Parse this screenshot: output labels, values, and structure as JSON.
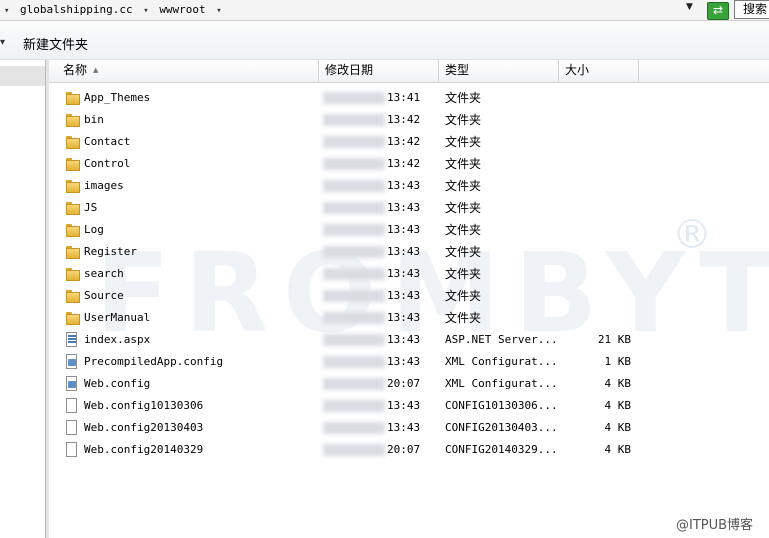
{
  "address": {
    "segments": [
      "globalshipping.cc",
      "wwwroot"
    ],
    "search_label": "搜索"
  },
  "toolbar": {
    "new_folder_label": "新建文件夹"
  },
  "columns": {
    "name": "名称",
    "date": "修改日期",
    "type": "类型",
    "size": "大小"
  },
  "files": [
    {
      "name": "App_Themes",
      "time": "13:41",
      "type": "文件夹",
      "size": "",
      "icon": "folder-icon"
    },
    {
      "name": "bin",
      "time": "13:42",
      "type": "文件夹",
      "size": "",
      "icon": "folder-icon"
    },
    {
      "name": "Contact",
      "time": "13:42",
      "type": "文件夹",
      "size": "",
      "icon": "folder-icon"
    },
    {
      "name": "Control",
      "time": "13:42",
      "type": "文件夹",
      "size": "",
      "icon": "folder-icon"
    },
    {
      "name": "images",
      "time": "13:43",
      "type": "文件夹",
      "size": "",
      "icon": "folder-icon"
    },
    {
      "name": "JS",
      "time": "13:43",
      "type": "文件夹",
      "size": "",
      "icon": "folder-icon"
    },
    {
      "name": "Log",
      "time": "13:43",
      "type": "文件夹",
      "size": "",
      "icon": "folder-icon"
    },
    {
      "name": "Register",
      "time": "13:43",
      "type": "文件夹",
      "size": "",
      "icon": "folder-icon"
    },
    {
      "name": "search",
      "time": "13:43",
      "type": "文件夹",
      "size": "",
      "icon": "folder-icon"
    },
    {
      "name": "Source",
      "time": "13:43",
      "type": "文件夹",
      "size": "",
      "icon": "folder-icon"
    },
    {
      "name": "UserManual",
      "time": "13:43",
      "type": "文件夹",
      "size": "",
      "icon": "folder-icon"
    },
    {
      "name": "index.aspx",
      "time": "13:43",
      "type": "ASP.NET Server...",
      "size": "21 KB",
      "icon": "aspx-file-icon"
    },
    {
      "name": "PrecompiledApp.config",
      "time": "13:43",
      "type": "XML Configurat...",
      "size": "1 KB",
      "icon": "config-file-icon"
    },
    {
      "name": "Web.config",
      "time": "20:07",
      "type": "XML Configurat...",
      "size": "4 KB",
      "icon": "config-file-icon"
    },
    {
      "name": "Web.config10130306",
      "time": "13:43",
      "type": "CONFIG10130306...",
      "size": "4 KB",
      "icon": "file-icon"
    },
    {
      "name": "Web.config20130403",
      "time": "13:43",
      "type": "CONFIG20130403...",
      "size": "4 KB",
      "icon": "file-icon"
    },
    {
      "name": "Web.config20140329",
      "time": "20:07",
      "type": "CONFIG20140329...",
      "size": "4 KB",
      "icon": "file-icon"
    }
  ],
  "watermark": {
    "text": "FROMBYTE",
    "mark": "®",
    "corner": "@ITPUB博客"
  }
}
